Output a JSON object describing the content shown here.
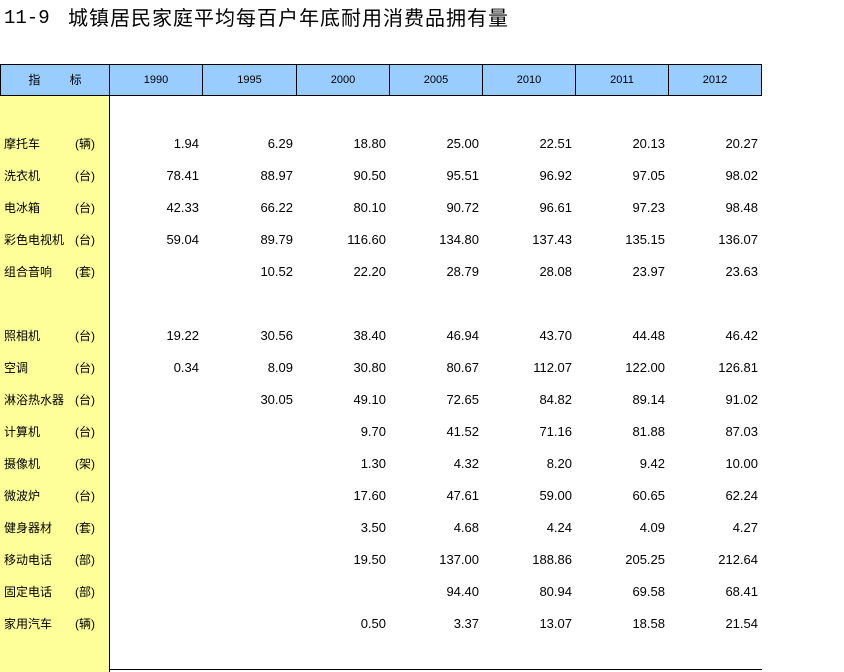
{
  "title": {
    "number": "11-9",
    "text": "城镇居民家庭平均每百户年底耐用消费品拥有量"
  },
  "colors": {
    "header_bg": "#99CCFF",
    "label_column_bg": "#FFFF99",
    "rule": "#000000"
  },
  "table": {
    "indicator_header": "指    标",
    "years": [
      "1990",
      "1995",
      "2000",
      "2005",
      "2010",
      "2011",
      "2012"
    ],
    "rows": [
      {
        "name": "摩托车",
        "unit": "(辆)",
        "values": [
          "1.94",
          "6.29",
          "18.80",
          "25.00",
          "22.51",
          "20.13",
          "20.27"
        ]
      },
      {
        "name": "洗衣机",
        "unit": "(台)",
        "values": [
          "78.41",
          "88.97",
          "90.50",
          "95.51",
          "96.92",
          "97.05",
          "98.02"
        ]
      },
      {
        "name": "电冰箱",
        "unit": "(台)",
        "values": [
          "42.33",
          "66.22",
          "80.10",
          "90.72",
          "96.61",
          "97.23",
          "98.48"
        ]
      },
      {
        "name": "彩色电视机",
        "unit": "(台)",
        "values": [
          "59.04",
          "89.79",
          "116.60",
          "134.80",
          "137.43",
          "135.15",
          "136.07"
        ]
      },
      {
        "name": "组合音响",
        "unit": "(套)",
        "values": [
          "",
          "10.52",
          "22.20",
          "28.79",
          "28.08",
          "23.97",
          "23.63"
        ]
      },
      {
        "name": "照相机",
        "unit": "(台)",
        "values": [
          "19.22",
          "30.56",
          "38.40",
          "46.94",
          "43.70",
          "44.48",
          "46.42"
        ]
      },
      {
        "name": "空调",
        "unit": "(台)",
        "values": [
          "0.34",
          "8.09",
          "30.80",
          "80.67",
          "112.07",
          "122.00",
          "126.81"
        ]
      },
      {
        "name": "淋浴热水器",
        "unit": "(台)",
        "values": [
          "",
          "30.05",
          "49.10",
          "72.65",
          "84.82",
          "89.14",
          "91.02"
        ]
      },
      {
        "name": "计算机",
        "unit": "(台)",
        "values": [
          "",
          "",
          "9.70",
          "41.52",
          "71.16",
          "81.88",
          "87.03"
        ]
      },
      {
        "name": "摄像机",
        "unit": "(架)",
        "values": [
          "",
          "",
          "1.30",
          "4.32",
          "8.20",
          "9.42",
          "10.00"
        ]
      },
      {
        "name": "微波炉",
        "unit": "(台)",
        "values": [
          "",
          "",
          "17.60",
          "47.61",
          "59.00",
          "60.65",
          "62.24"
        ]
      },
      {
        "name": "健身器材",
        "unit": "(套)",
        "values": [
          "",
          "",
          "3.50",
          "4.68",
          "4.24",
          "4.09",
          "4.27"
        ]
      },
      {
        "name": "移动电话",
        "unit": "(部)",
        "values": [
          "",
          "",
          "19.50",
          "137.00",
          "188.86",
          "205.25",
          "212.64"
        ]
      },
      {
        "name": "固定电话",
        "unit": "(部)",
        "values": [
          "",
          "",
          "",
          "94.40",
          "80.94",
          "69.58",
          "68.41"
        ]
      },
      {
        "name": "家用汽车",
        "unit": "(辆)",
        "values": [
          "",
          "",
          "0.50",
          "3.37",
          "13.07",
          "18.58",
          "21.54"
        ]
      }
    ]
  }
}
